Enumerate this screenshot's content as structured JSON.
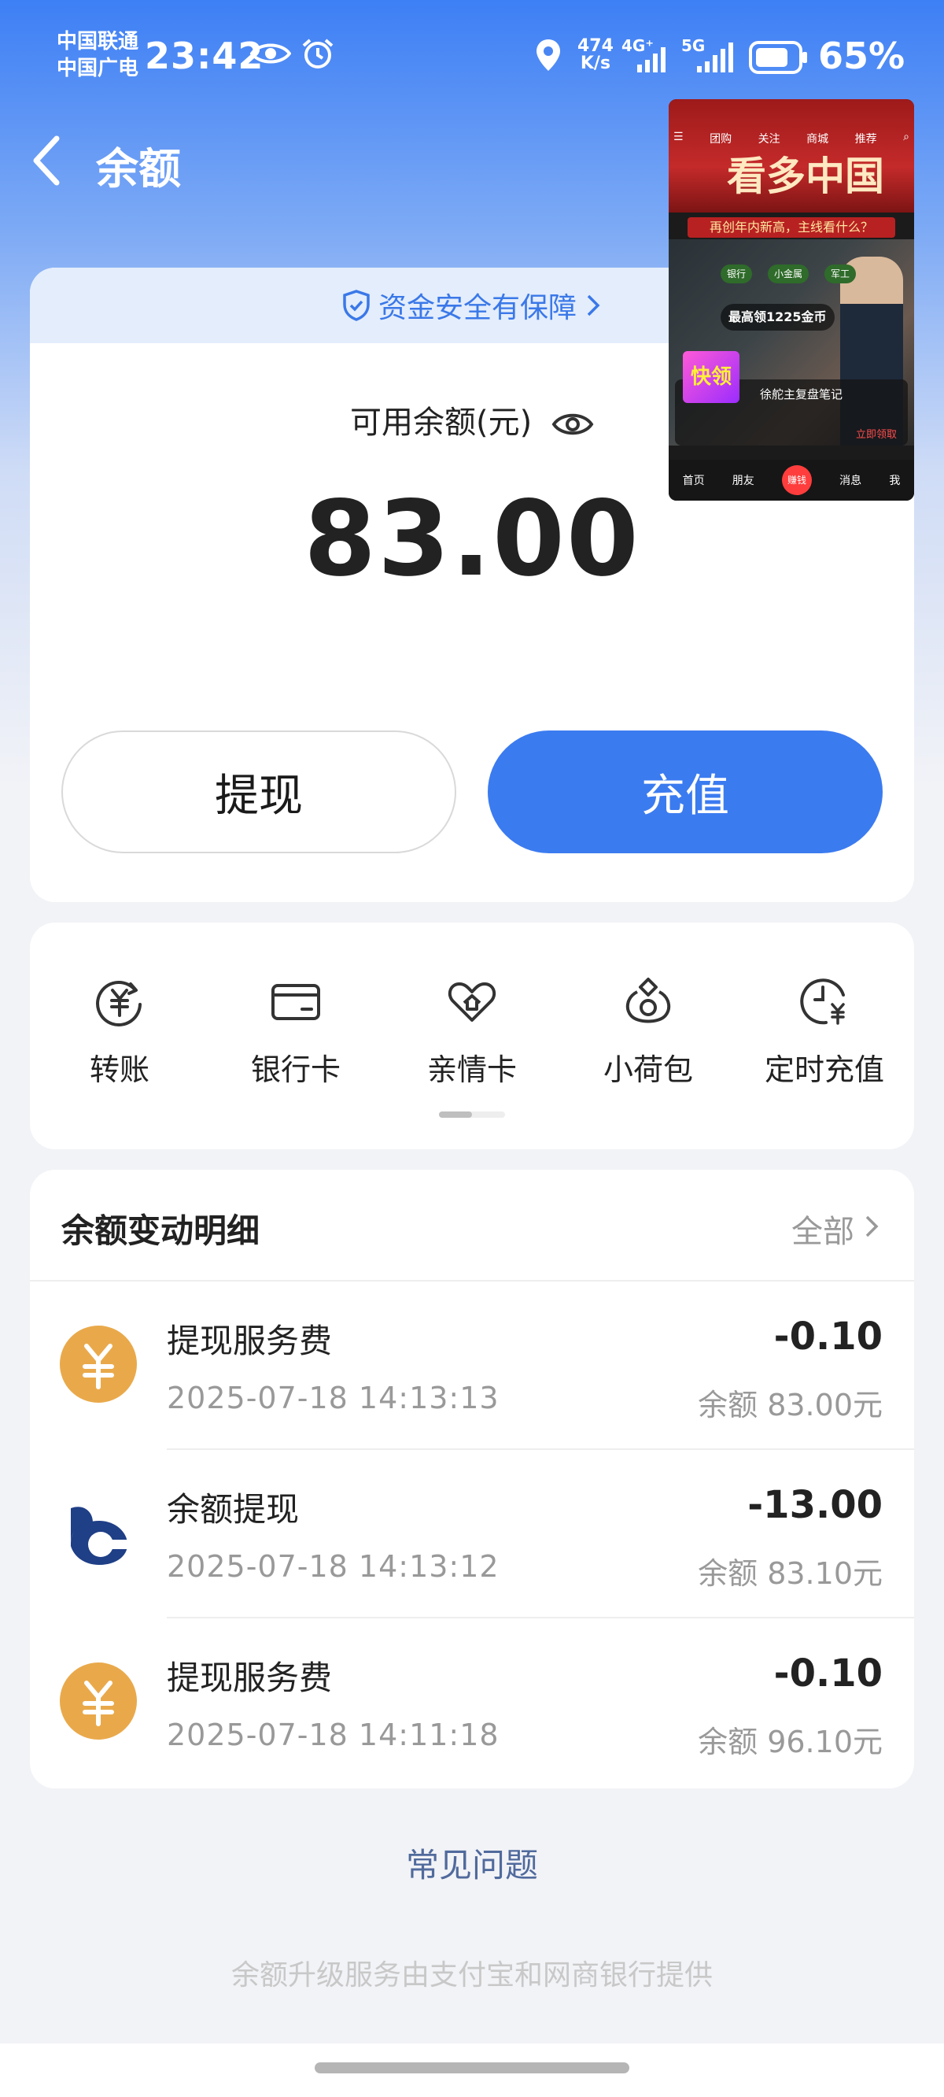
{
  "status_bar": {
    "carrier1": "中国联通",
    "carrier2": "中国广电",
    "time": "23:42",
    "net_speed_value": "474",
    "net_speed_unit": "K/s",
    "net4g": "4G⁺",
    "net5g": "5G",
    "battery": "65%"
  },
  "header": {
    "title": "余额"
  },
  "balance_card": {
    "safety_text": "资金安全有保障",
    "label": "可用余额(元)",
    "amount": "83.00",
    "withdraw_label": "提现",
    "recharge_label": "充值"
  },
  "shortcuts": [
    {
      "label": "转账",
      "icon": "transfer-yuan-icon"
    },
    {
      "label": "银行卡",
      "icon": "bank-card-icon"
    },
    {
      "label": "亲情卡",
      "icon": "family-card-icon"
    },
    {
      "label": "小荷包",
      "icon": "small-pouch-icon"
    },
    {
      "label": "定时充值",
      "icon": "scheduled-recharge-icon"
    }
  ],
  "transactions": {
    "title": "余额变动明细",
    "all_label": "全部",
    "items": [
      {
        "name": "提现服务费",
        "date": "2025-07-18 14:13:13",
        "amount": "-0.10",
        "balance": "余额 83.00元",
        "icon": "yuan-fee-icon"
      },
      {
        "name": "余额提现",
        "date": "2025-07-18 14:13:12",
        "amount": "-13.00",
        "balance": "余额 83.10元",
        "icon": "bank-logo-icon"
      },
      {
        "name": "提现服务费",
        "date": "2025-07-18 14:11:18",
        "amount": "-0.10",
        "balance": "余额 96.10元",
        "icon": "yuan-fee-icon"
      }
    ]
  },
  "faq_label": "常见问题",
  "footer_text": "余额升级服务由支付宝和网商银行提供",
  "pip": {
    "nav": [
      "团购",
      "关注",
      "商城",
      "推荐"
    ],
    "headline": "看多中国",
    "subline": "再创年内新高，主线看什么？",
    "tags": [
      "银行",
      "小金属",
      "军工"
    ],
    "coin_text": "最高领1225金币",
    "card_thumb": "快领",
    "card_title": "徐舵主复盘笔记",
    "card_link": "立即领取",
    "bottom_nav": [
      "首页",
      "朋友",
      "赚钱",
      "消息",
      "我"
    ]
  },
  "colors": {
    "primary": "#3b7bf0",
    "coin": "#e9a94b",
    "bank_logo": "#1f3f86"
  }
}
